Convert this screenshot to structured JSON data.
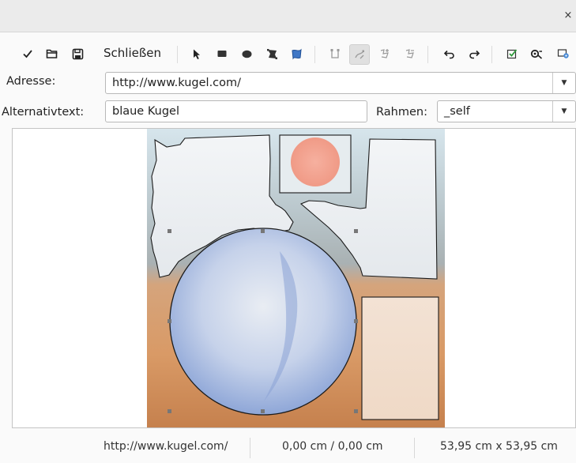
{
  "window": {
    "close_glyph": "×"
  },
  "toolbar": {
    "close_label": "Schließen",
    "icons": [
      "apply-check-icon",
      "open-folder-icon",
      "save-icon",
      "select-pointer-icon",
      "rectangle-icon",
      "ellipse-icon",
      "polygon-icon",
      "freeform-polygon-icon",
      "edit-points-icon",
      "move-points-icon",
      "insert-points-icon",
      "delete-points-icon",
      "undo-icon",
      "redo-icon",
      "active-icon",
      "macro-icon",
      "properties-icon"
    ]
  },
  "form": {
    "address_label": "Adresse:",
    "address_value": "http://www.kugel.com/",
    "alt_label": "Alternativtext:",
    "alt_value": "blaue Kugel",
    "frame_label": "Rahmen:",
    "frame_value": "_self"
  },
  "status": {
    "url": "http://www.kugel.com/",
    "position": "0,00 cm / 0,00 cm",
    "size": "53,95 cm x 53,95 cm"
  },
  "colors": {
    "sky_top": "#d8e6ec",
    "sky_bottom": "#a9b4b9",
    "ground_top": "#d9a377",
    "ground_bottom": "#c4824f",
    "sphere_blue": "#8ea7d8",
    "sun": "#f2a391"
  }
}
